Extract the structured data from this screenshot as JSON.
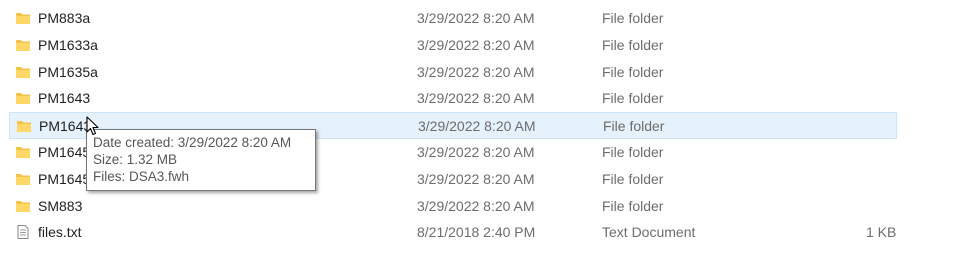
{
  "files": [
    {
      "name": "PM883a",
      "date": "3/29/2022 8:20 AM",
      "type": "File folder",
      "size": "",
      "icon": "folder-icon"
    },
    {
      "name": "PM1633a",
      "date": "3/29/2022 8:20 AM",
      "type": "File folder",
      "size": "",
      "icon": "folder-icon"
    },
    {
      "name": "PM1635a",
      "date": "3/29/2022 8:20 AM",
      "type": "File folder",
      "size": "",
      "icon": "folder-icon"
    },
    {
      "name": "PM1643",
      "date": "3/29/2022 8:20 AM",
      "type": "File folder",
      "size": "",
      "icon": "folder-icon"
    },
    {
      "name": "PM1643",
      "date": "3/29/2022 8:20 AM",
      "type": "File folder",
      "size": "",
      "icon": "folder-icon",
      "selected": true
    },
    {
      "name": "PM1645",
      "date": "3/29/2022 8:20 AM",
      "type": "File folder",
      "size": "",
      "icon": "folder-icon"
    },
    {
      "name": "PM1645",
      "date": "3/29/2022 8:20 AM",
      "type": "File folder",
      "size": "",
      "icon": "folder-icon"
    },
    {
      "name": "SM883",
      "date": "3/29/2022 8:20 AM",
      "type": "File folder",
      "size": "",
      "icon": "folder-icon"
    },
    {
      "name": "files.txt",
      "date": "8/21/2018 2:40 PM",
      "type": "Text Document",
      "size": "1 KB",
      "icon": "text-file-icon"
    }
  ],
  "tooltip": {
    "date_created": "Date created: 3/29/2022 8:20 AM",
    "size": "Size: 1.32 MB",
    "files": "Files: DSA3.fwh"
  },
  "colors": {
    "folder": "#f3c34b",
    "selection": "#e5f1fb",
    "selection_border": "#cce4f7",
    "secondary_text": "#6d6d6d"
  }
}
